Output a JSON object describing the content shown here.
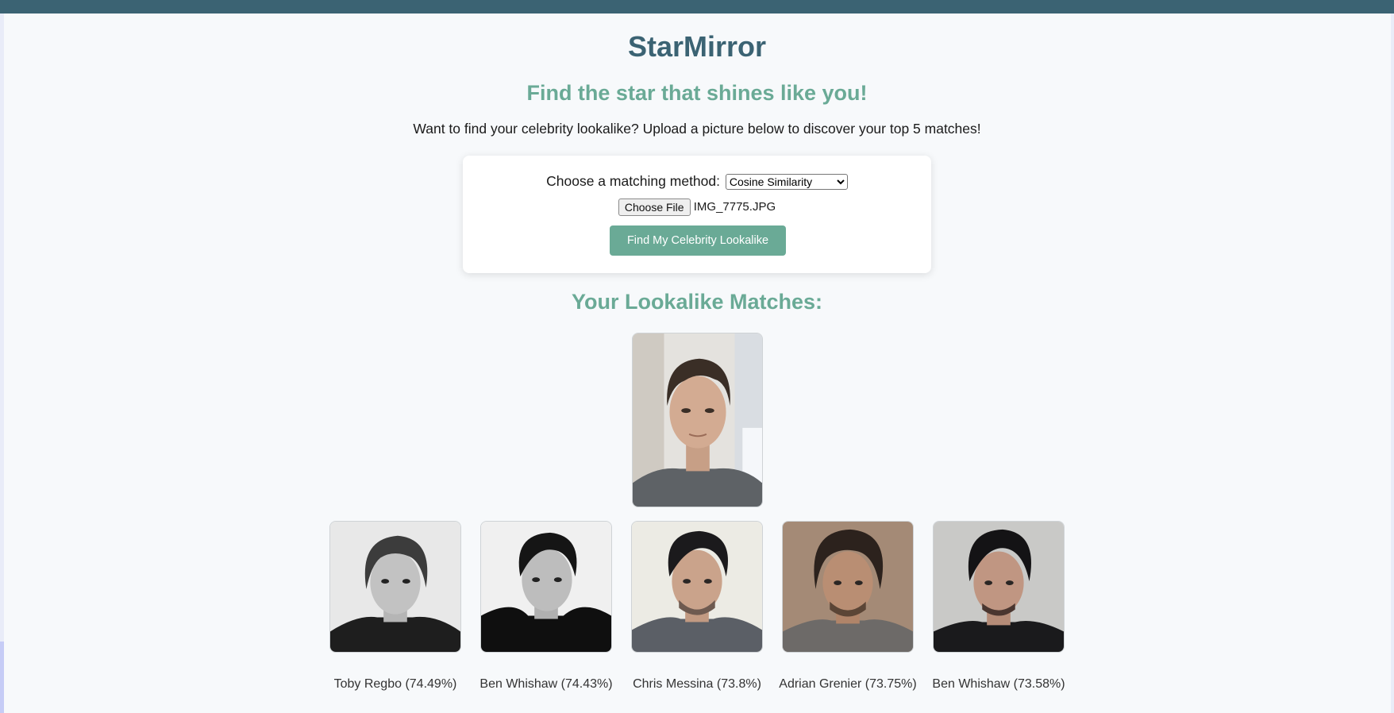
{
  "app": {
    "title": "StarMirror",
    "tagline": "Find the star that shines like you!",
    "intro": "Want to find your celebrity lookalike? Upload a picture below to discover your top 5 matches!"
  },
  "form": {
    "method_label": "Choose a matching method:",
    "method_selected": "Cosine Similarity",
    "choose_file_label": "Choose File",
    "file_name": "IMG_7775.JPG",
    "submit_label": "Find My Celebrity Lookalike"
  },
  "results": {
    "heading": "Your Lookalike Matches:",
    "matches": [
      {
        "caption": "Toby Regbo (74.49%)"
      },
      {
        "caption": "Ben Whishaw (74.43%)"
      },
      {
        "caption": "Chris Messina (73.8%)"
      },
      {
        "caption": "Adrian Grenier (73.75%)"
      },
      {
        "caption": "Ben Whishaw (73.58%)"
      }
    ]
  },
  "colors": {
    "header_bar": "#3b6373",
    "accent": "#6aaa96",
    "background": "#f7f9fb"
  }
}
